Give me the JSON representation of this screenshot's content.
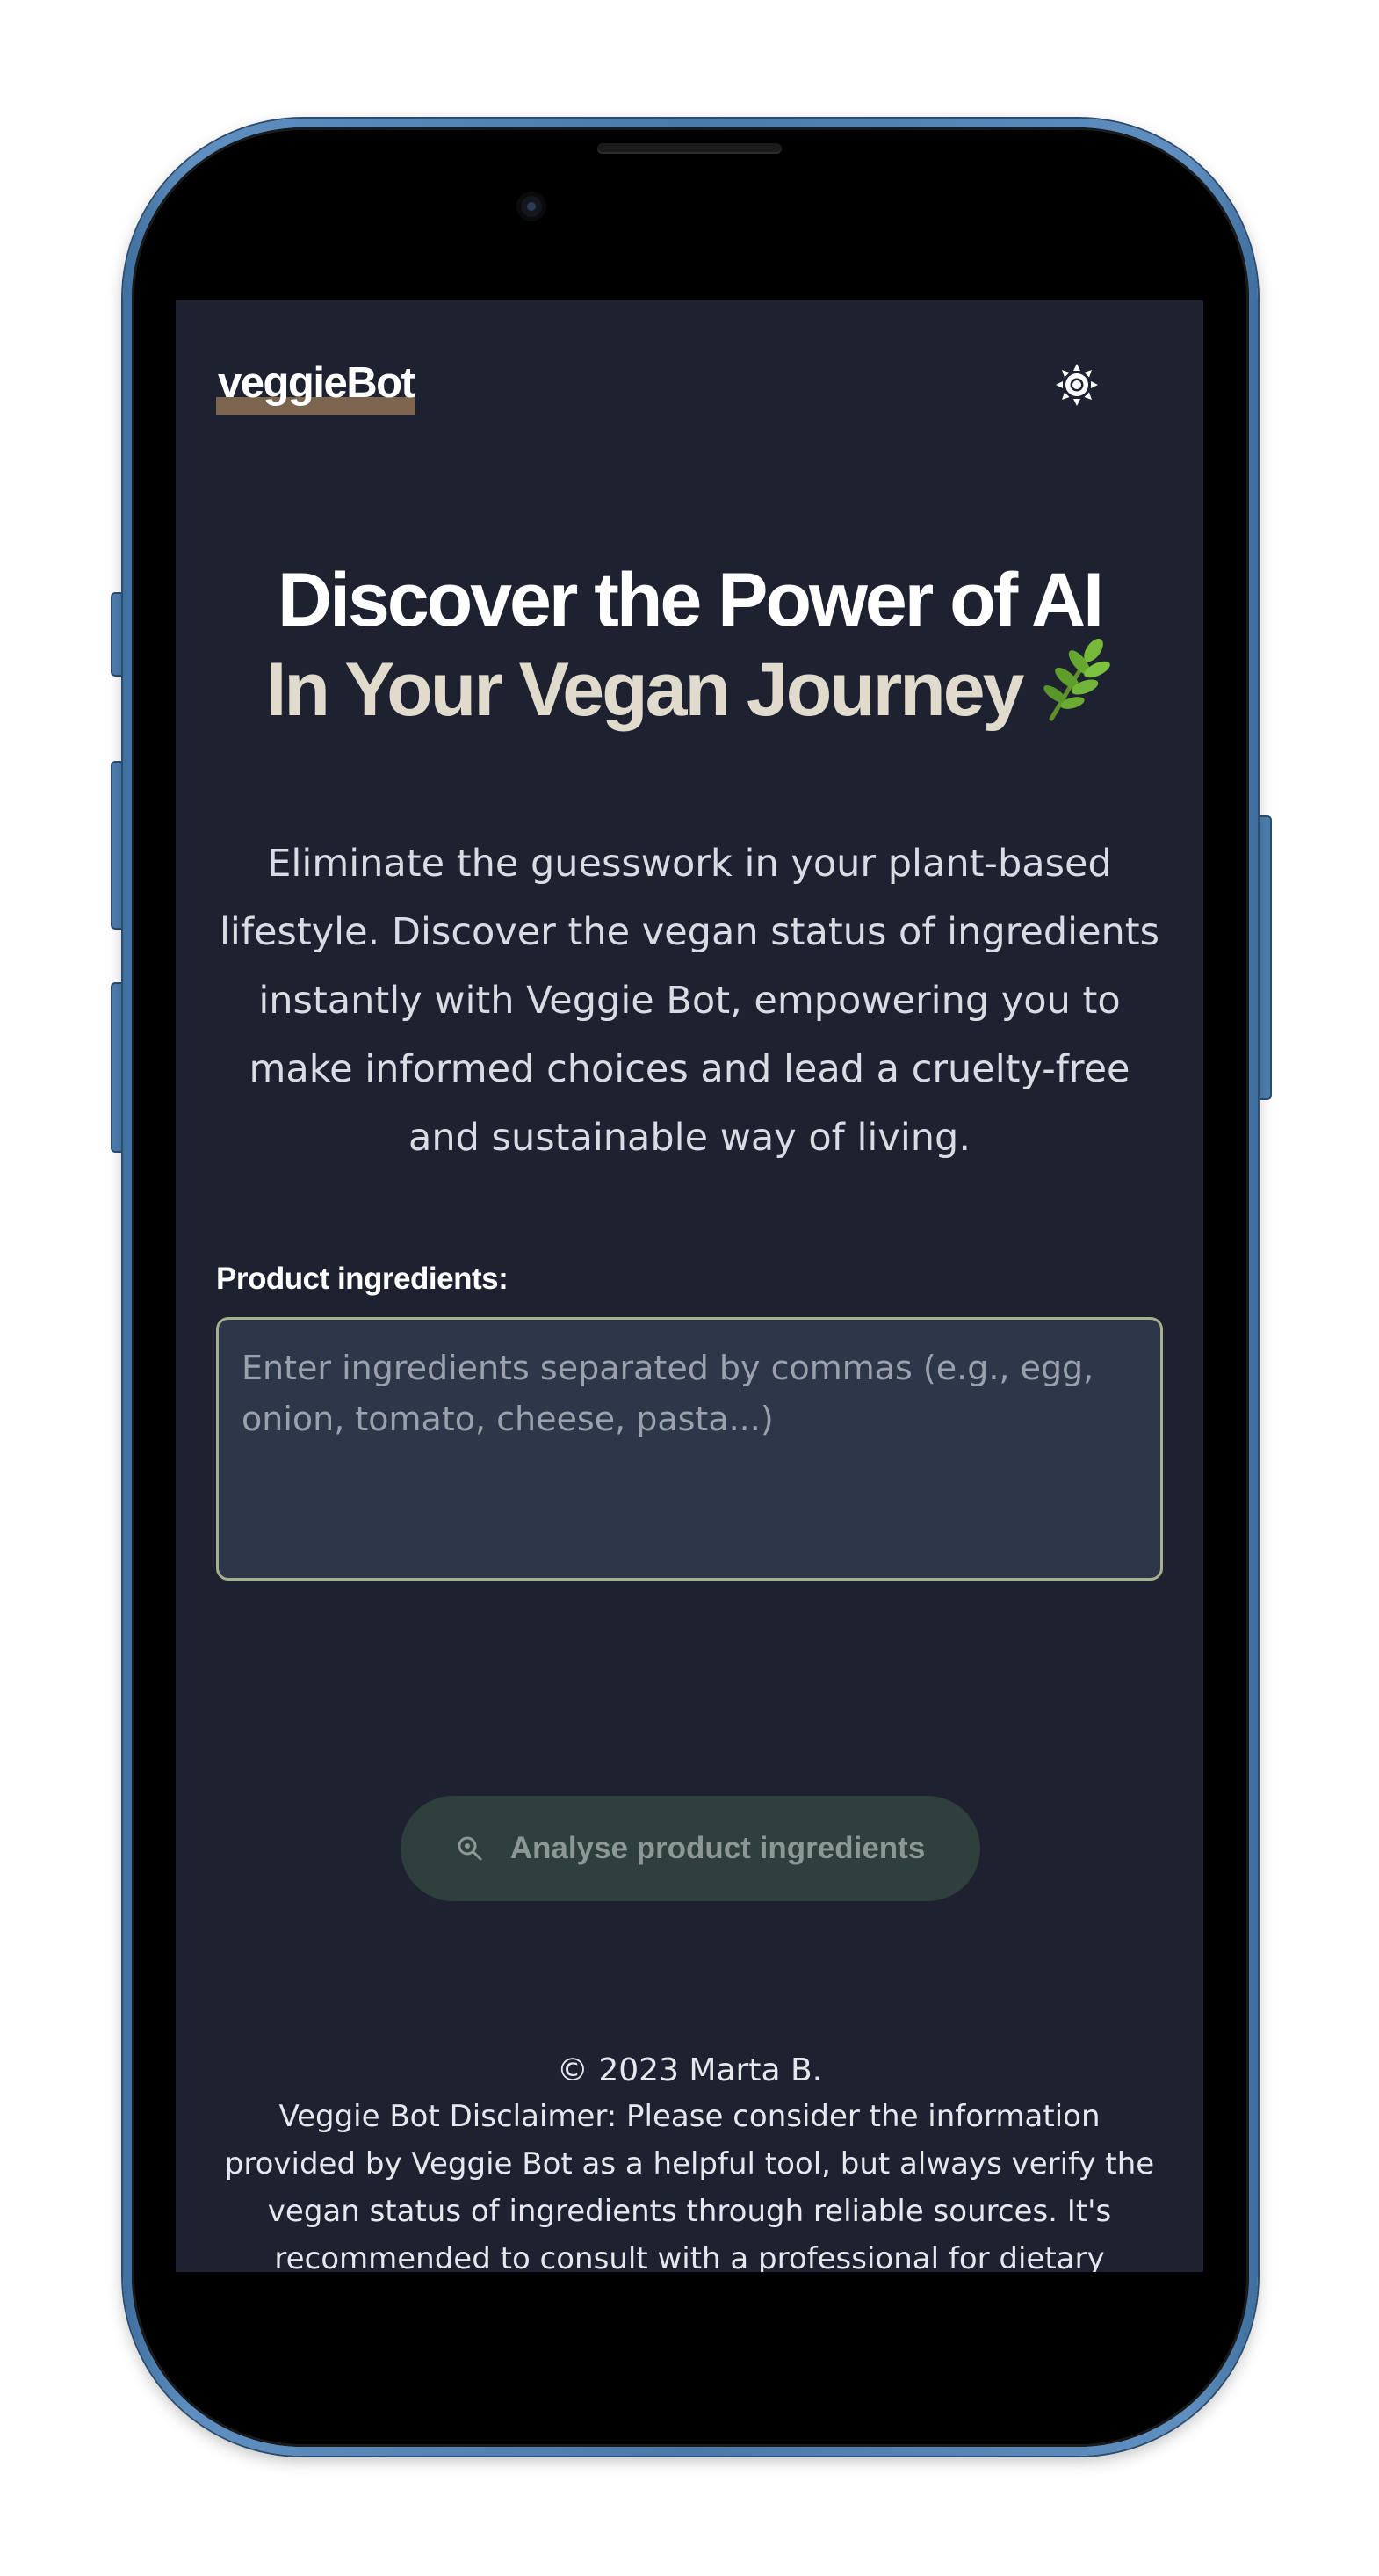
{
  "app": {
    "logo_text": "veggieBot",
    "theme_toggle_icon": "sun-icon",
    "brand_underline_color": "#7c654f"
  },
  "hero": {
    "title_line1": "Discover the Power of AI",
    "title_line2": "In Your Vegan Journey",
    "title_emoji_icon": "herb-leaf-icon",
    "description": "Eliminate the guesswork in your plant-based lifestyle. Discover the vegan status of ingredients instantly with Veggie Bot, empowering you to make informed choices and lead a cruelty-free and sustainable way of living."
  },
  "form": {
    "label": "Product ingredients:",
    "placeholder": "Enter ingredients separated by commas (e.g., egg, onion, tomato, cheese, pasta...)",
    "value": "",
    "submit_label": "Analyse product ingredients",
    "submit_icon": "search-icon"
  },
  "footer": {
    "copyright": "© 2023 Marta B.",
    "disclaimer": "Veggie Bot Disclaimer: Please consider the information provided by Veggie Bot as a helpful tool, but always verify the vegan status of ingredients through reliable sources. It's recommended to consult with a professional for dietary concerns. Veggie Bot"
  },
  "colors": {
    "screen_background": "#1e2230",
    "input_background": "#2e3649",
    "input_border": "#a6b08c",
    "button_background": "#2e3f3d",
    "phone_frame": "#4a7aa9"
  }
}
